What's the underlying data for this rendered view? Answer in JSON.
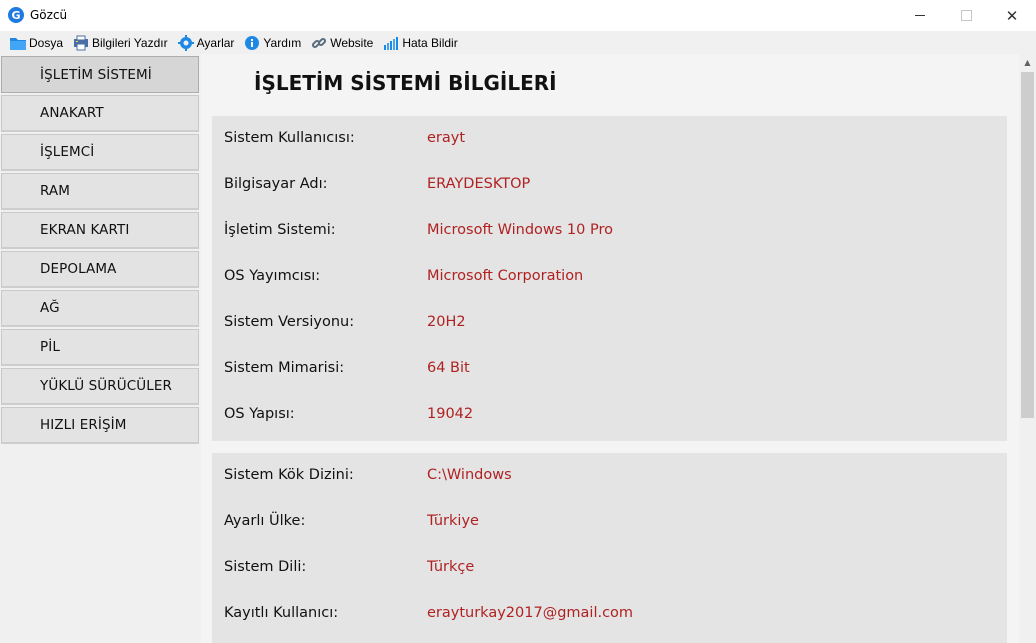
{
  "window": {
    "title": "Gözcü",
    "icon_letter": "G"
  },
  "menu": [
    {
      "label": "Dosya",
      "icon": "folder-icon"
    },
    {
      "label": "Bilgileri Yazdır",
      "icon": "printer-icon"
    },
    {
      "label": "Ayarlar",
      "icon": "gear-icon"
    },
    {
      "label": "Yardım",
      "icon": "info-icon"
    },
    {
      "label": "Website",
      "icon": "link-icon"
    },
    {
      "label": "Hata Bildir",
      "icon": "bar-chart-icon"
    }
  ],
  "sidebar": {
    "items": [
      {
        "label": "İŞLETİM SİSTEMİ",
        "active": true
      },
      {
        "label": "ANAKART"
      },
      {
        "label": "İŞLEMCİ"
      },
      {
        "label": "RAM"
      },
      {
        "label": "EKRAN KARTI"
      },
      {
        "label": "DEPOLAMA"
      },
      {
        "label": "AĞ"
      },
      {
        "label": "PİL"
      },
      {
        "label": "YÜKLÜ SÜRÜCÜLER"
      },
      {
        "label": "HIZLI ERİŞİM"
      }
    ]
  },
  "main": {
    "title": "İŞLETİM SİSTEMİ BİLGİLERİ",
    "panels": [
      {
        "rows": [
          {
            "label": "Sistem Kullanıcısı:",
            "value": "erayt"
          },
          {
            "label": "Bilgisayar Adı:",
            "value": "ERAYDESKTOP"
          },
          {
            "label": "İşletim Sistemi:",
            "value": "Microsoft Windows 10 Pro"
          },
          {
            "label": "OS Yayımcısı:",
            "value": "Microsoft Corporation"
          },
          {
            "label": "Sistem Versiyonu:",
            "value": "20H2"
          },
          {
            "label": "Sistem Mimarisi:",
            "value": "64 Bit"
          },
          {
            "label": "OS Yapısı:",
            "value": "19042"
          }
        ]
      },
      {
        "rows": [
          {
            "label": "Sistem Kök Dizini:",
            "value": "C:\\Windows"
          },
          {
            "label": "Ayarlı Ülke:",
            "value": "Türkiye"
          },
          {
            "label": "Sistem Dili:",
            "value": "Türkçe"
          },
          {
            "label": "Kayıtlı Kullanıcı:",
            "value": "erayturkay2017@gmail.com"
          }
        ]
      }
    ]
  },
  "colors": {
    "value_text": "#b02222",
    "panel_bg": "#e4e4e4",
    "sidebar_bg": "#f0f0f0"
  }
}
